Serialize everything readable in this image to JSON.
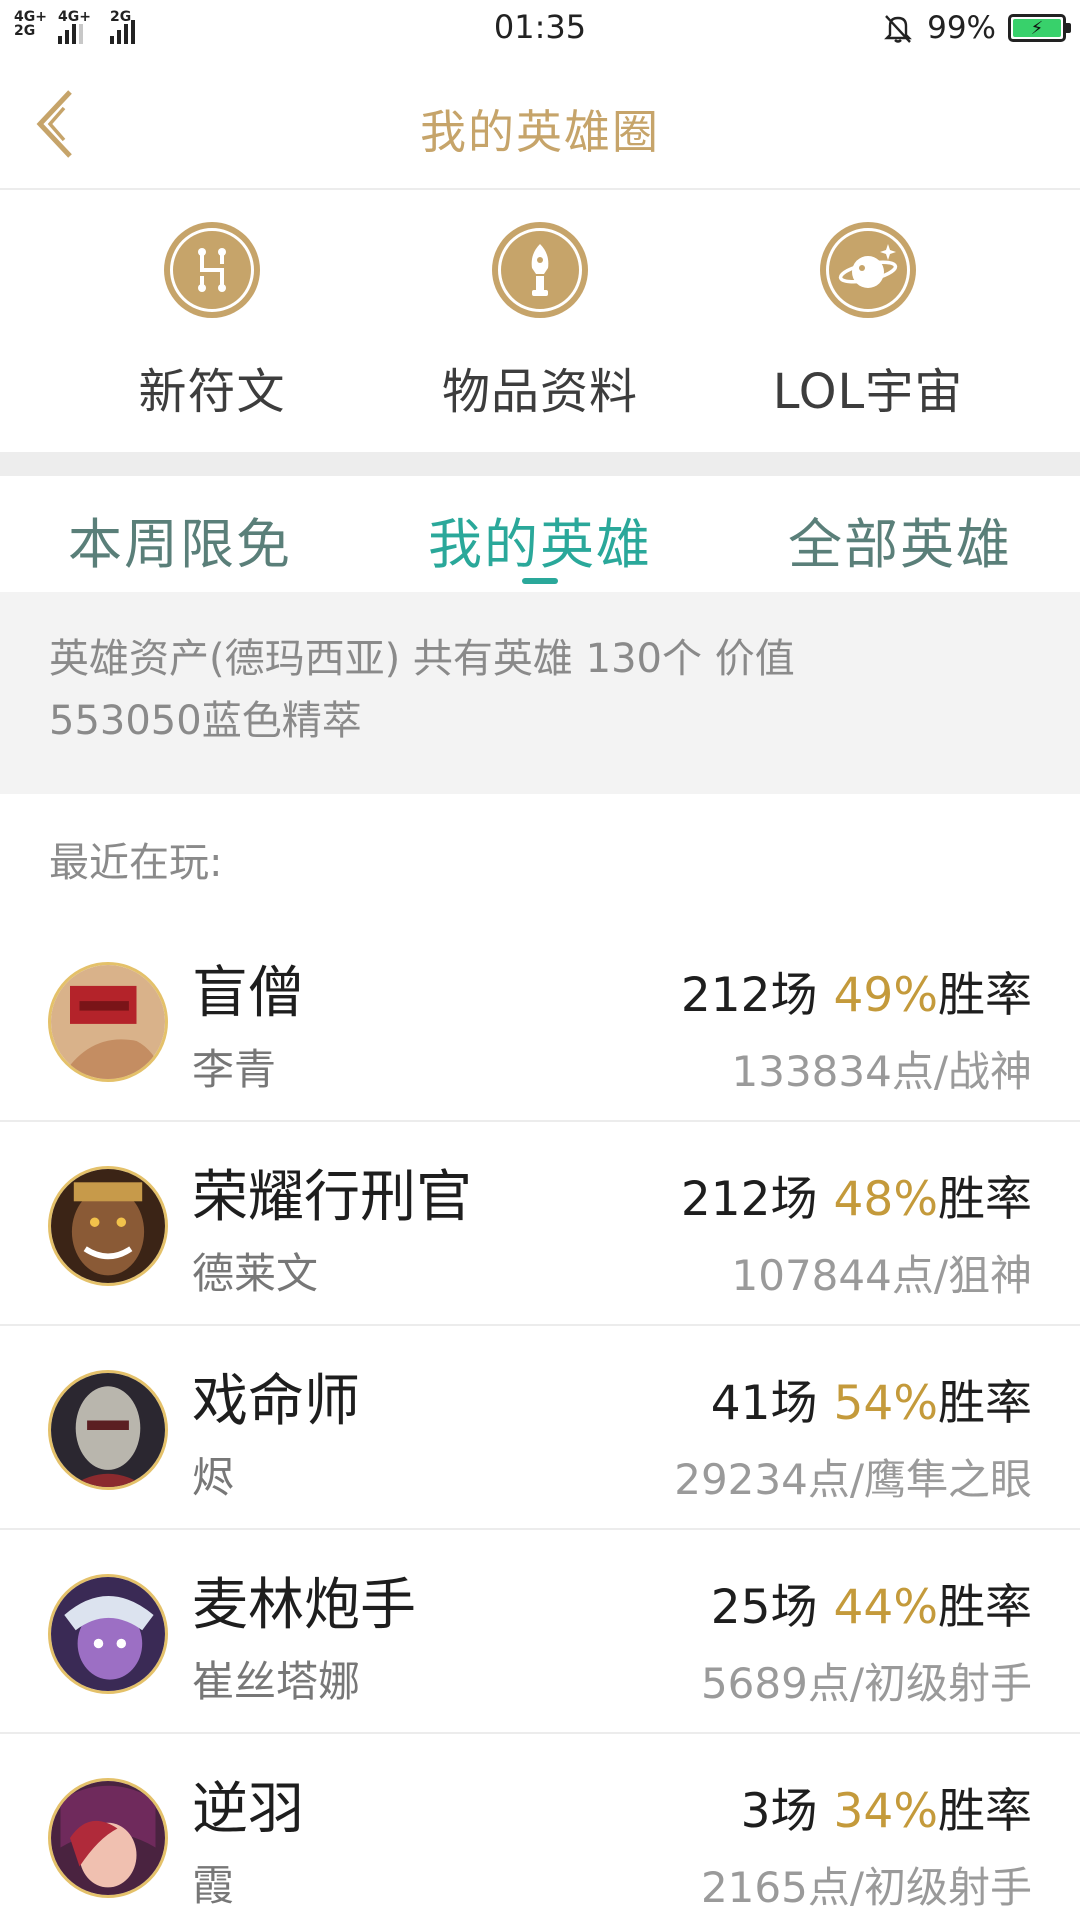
{
  "status_bar": {
    "network1": "4G+",
    "network2": "4G+",
    "network3": "2G",
    "network4": "2G",
    "time": "01:35",
    "battery": "99%",
    "icons": [
      "signal-icon",
      "mute-bell-icon",
      "battery-charging-icon"
    ]
  },
  "header": {
    "title": "我的英雄圈",
    "back_icon": "chevron-left-icon",
    "accent_color": "#c6a46a"
  },
  "quick_links": [
    {
      "label": "新符文",
      "icon": "rune-icon"
    },
    {
      "label": "物品资料",
      "icon": "item-icon"
    },
    {
      "label": "LOL宇宙",
      "icon": "universe-icon"
    }
  ],
  "tabs": [
    {
      "label": "本周限免",
      "active": false
    },
    {
      "label": "我的英雄",
      "active": true
    },
    {
      "label": "全部英雄",
      "active": false
    }
  ],
  "summary": {
    "line1": "英雄资产(德玛西亚)  共有英雄 130个  价值",
    "line2": "553050蓝色精萃"
  },
  "recent_label": "最近在玩:",
  "heroes": [
    {
      "title": "盲僧",
      "name": "李青",
      "games": "212场",
      "rate": "49%",
      "rate_suffix": "胜率",
      "points": "133834点/战神"
    },
    {
      "title": "荣耀行刑官",
      "name": "德莱文",
      "games": "212场",
      "rate": "48%",
      "rate_suffix": "胜率",
      "points": "107844点/狙神"
    },
    {
      "title": "戏命师",
      "name": "烬",
      "games": "41场",
      "rate": "54%",
      "rate_suffix": "胜率",
      "points": "29234点/鹰隼之眼"
    },
    {
      "title": "麦林炮手",
      "name": "崔丝塔娜",
      "games": "25场",
      "rate": "44%",
      "rate_suffix": "胜率",
      "points": "5689点/初级射手"
    },
    {
      "title": "逆羽",
      "name": "霞",
      "games": "3场",
      "rate": "34%",
      "rate_suffix": "胜率",
      "points": "2165点/初级射手"
    }
  ]
}
